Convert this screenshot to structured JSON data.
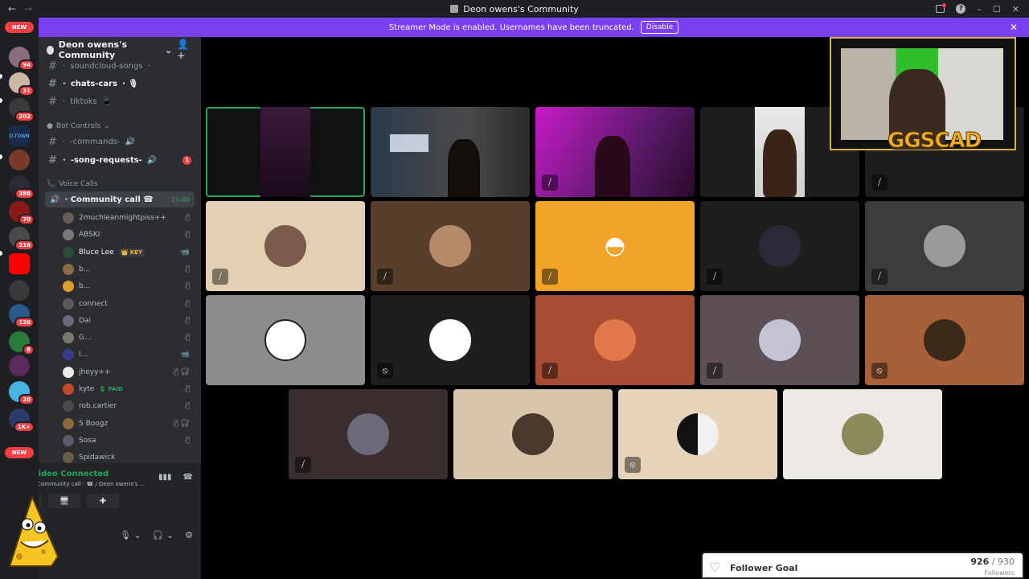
{
  "window": {
    "title": "Deon owens's Community",
    "back": "←",
    "forward": "→",
    "min": "–",
    "max": "☐",
    "close": "✕"
  },
  "banner": {
    "text": "Streamer Mode is enabled. Usernames have been truncated.",
    "button": "Disable",
    "close": "✕"
  },
  "guilds": {
    "new_top": "NEW",
    "new_bottom": "NEW",
    "badges": [
      "94",
      "31",
      "202",
      "388",
      "70",
      "216",
      "126",
      "8",
      "20",
      "1K+"
    ],
    "dtown": "D-TOWN"
  },
  "server": {
    "name": "Deon owens's Community"
  },
  "channels": [
    {
      "name": "soundcloud-songs",
      "decor": "· ",
      "suffix": "·"
    },
    {
      "name": "chats-cars",
      "decor": "· ",
      "suffix": "· 🎙"
    },
    {
      "name": "tiktoks",
      "decor": "· ",
      "suffix": "📱"
    }
  ],
  "bot_controls": {
    "label": "Bot Controls",
    "channels": [
      {
        "name": "-commands-",
        "prefix": "·",
        "suffix": "🔊"
      },
      {
        "name": "-song-requests-",
        "prefix": "·",
        "suffix": "🔊",
        "unread": "1"
      }
    ]
  },
  "voice_calls": {
    "label": "Voice Calls",
    "channel": "Community call",
    "channel_prefix": "· ",
    "channel_suffix": "☎",
    "time": "15:49"
  },
  "voice_users": [
    {
      "name": "2muchleanmightpiss++",
      "status": "🎙̸"
    },
    {
      "name": "ABSKI",
      "status": "🎙̸"
    },
    {
      "name": "Bluce Lee",
      "tag": "👑 KEY",
      "status": "📹"
    },
    {
      "name": "b...",
      "status": "🎙̸"
    },
    {
      "name": "b...",
      "status": "🎙̸"
    },
    {
      "name": "connect",
      "status": "🎙̸"
    },
    {
      "name": "Dai",
      "status": "🎙̸"
    },
    {
      "name": "G...",
      "status": "🎙̸"
    },
    {
      "name": "l...",
      "status": "📹"
    },
    {
      "name": "jheyy++",
      "status": "🎙̸ 🎧̸"
    },
    {
      "name": "kyte",
      "tag": "💲 PAID",
      "status": "🎙̸"
    },
    {
      "name": "rob.cartier",
      "status": "🎙̸"
    },
    {
      "name": "S Boogz",
      "status": "🎙̸ 🎧̸"
    },
    {
      "name": "Sosa",
      "status": "🎙̸"
    },
    {
      "name": "Spidawick",
      "status": ""
    }
  ],
  "vc_panel": {
    "status": "Video Connected",
    "sub": "Community call · ☎ / Deon owens's ..."
  },
  "overlay": {
    "cam_logo": "GGSCAD"
  },
  "follower_goal": {
    "label": "Follower Goal",
    "current": "926",
    "separator": " / ",
    "target": "930",
    "sub": "Followers"
  },
  "colors": {
    "accent": "#5865f2",
    "banner": "#7b3ff2",
    "connected": "#23a55a",
    "danger": "#f23f43"
  }
}
